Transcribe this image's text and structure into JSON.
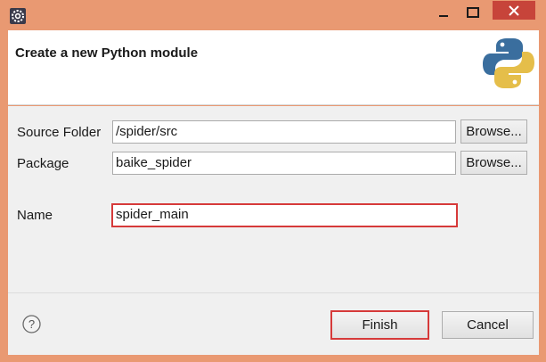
{
  "window": {
    "app_icon": "eclipse-gear-icon",
    "minimize_icon": "minimize-icon",
    "maximize_icon": "maximize-icon",
    "close_icon": "close-icon",
    "close_color": "#c7443a",
    "frame_color": "#e99972"
  },
  "header": {
    "title": "Create a new Python module",
    "logo": "python-logo-icon"
  },
  "form": {
    "source_folder_label": "Source Folder",
    "source_folder_value": "/spider/src",
    "package_label": "Package",
    "package_value": "baike_spider",
    "name_label": "Name",
    "name_value": "spider_main",
    "browse_label": "Browse...",
    "highlight_color": "#d63a3a"
  },
  "footer": {
    "help_icon": "help-icon",
    "finish_label": "Finish",
    "cancel_label": "Cancel"
  }
}
